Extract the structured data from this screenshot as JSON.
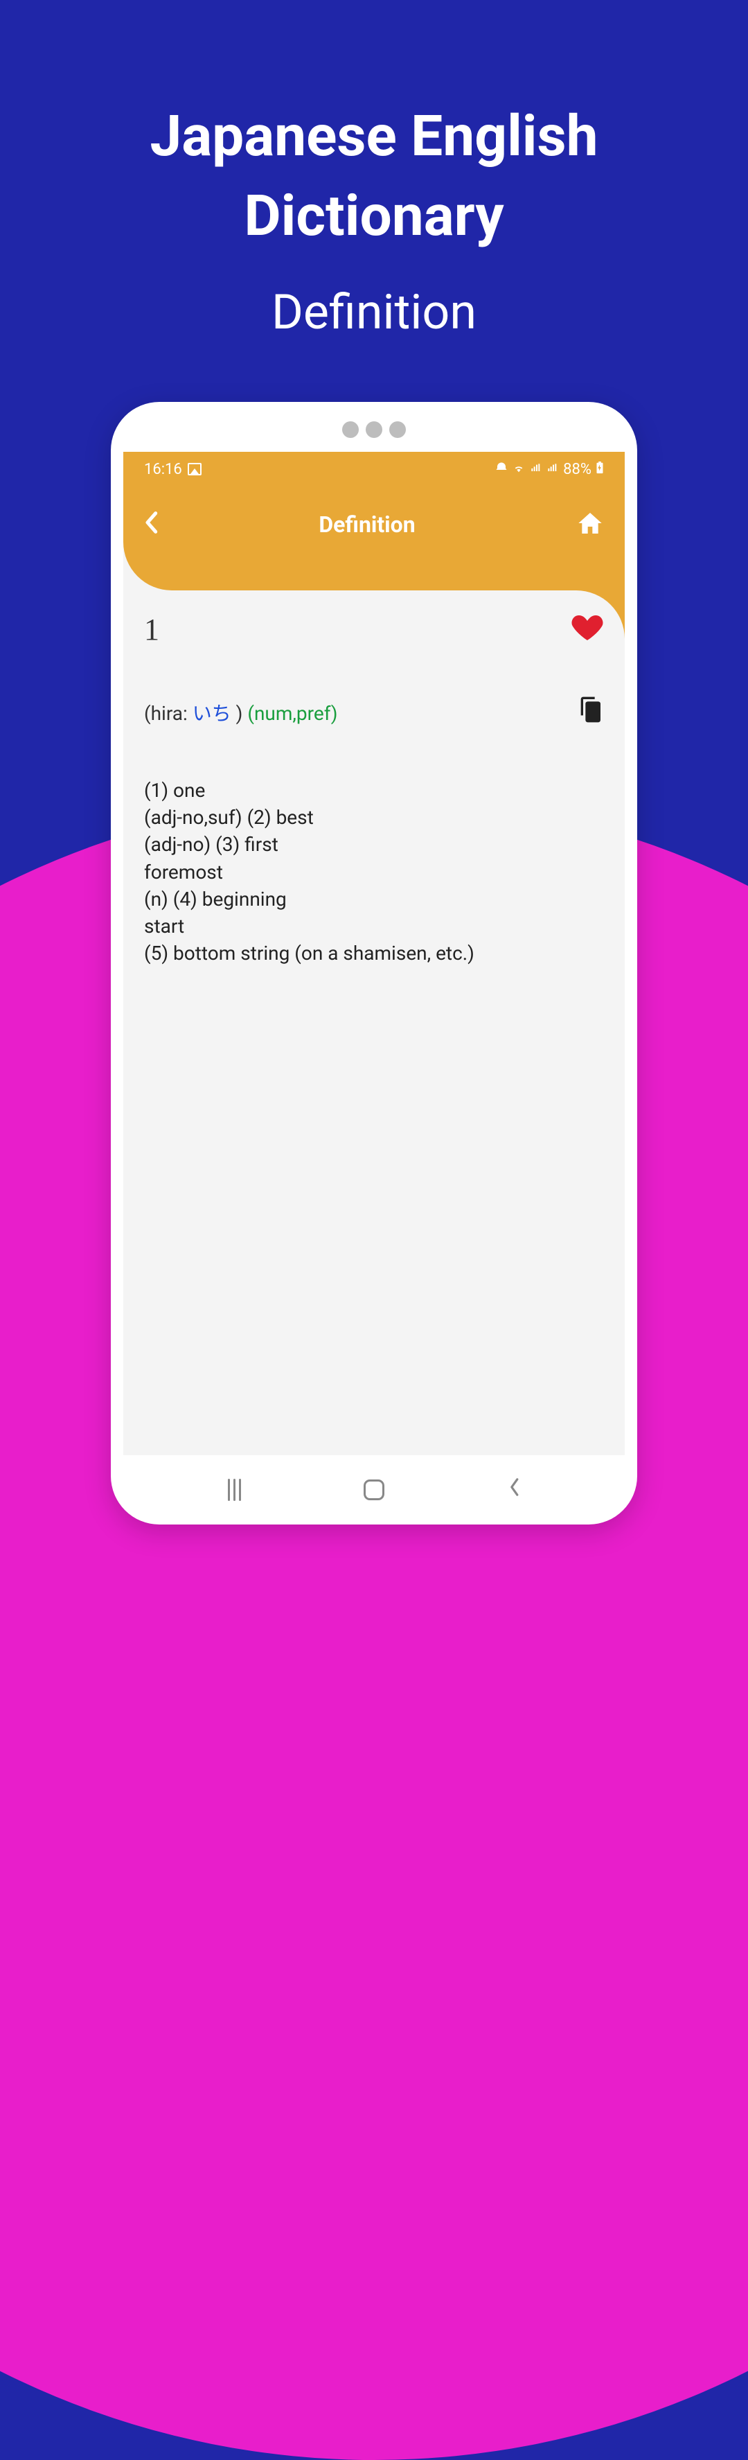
{
  "promo": {
    "title_line1": "Japanese English",
    "title_line2": "Dictionary",
    "subtitle": "Definition"
  },
  "statusbar": {
    "time": "16:16",
    "battery": "88%"
  },
  "appbar": {
    "title": "Definition"
  },
  "entry": {
    "headword": "1",
    "reading_prefix": "(hira: ",
    "reading_hira": "いち",
    "reading_close": " ) ",
    "pos": "(num,pref)",
    "definitions": "(1) one\n(adj-no,suf) (2) best\n(adj-no) (3) first\nforemost\n(n) (4) beginning\nstart\n(5) bottom string (on a shamisen, etc.)"
  },
  "colors": {
    "primary_bg": "#2026a8",
    "accent_pink": "#e81ecb",
    "header_orange": "#e8a836",
    "heart": "#e0202f",
    "link_blue": "#1e4fd9",
    "pos_green": "#1a9e3e"
  }
}
